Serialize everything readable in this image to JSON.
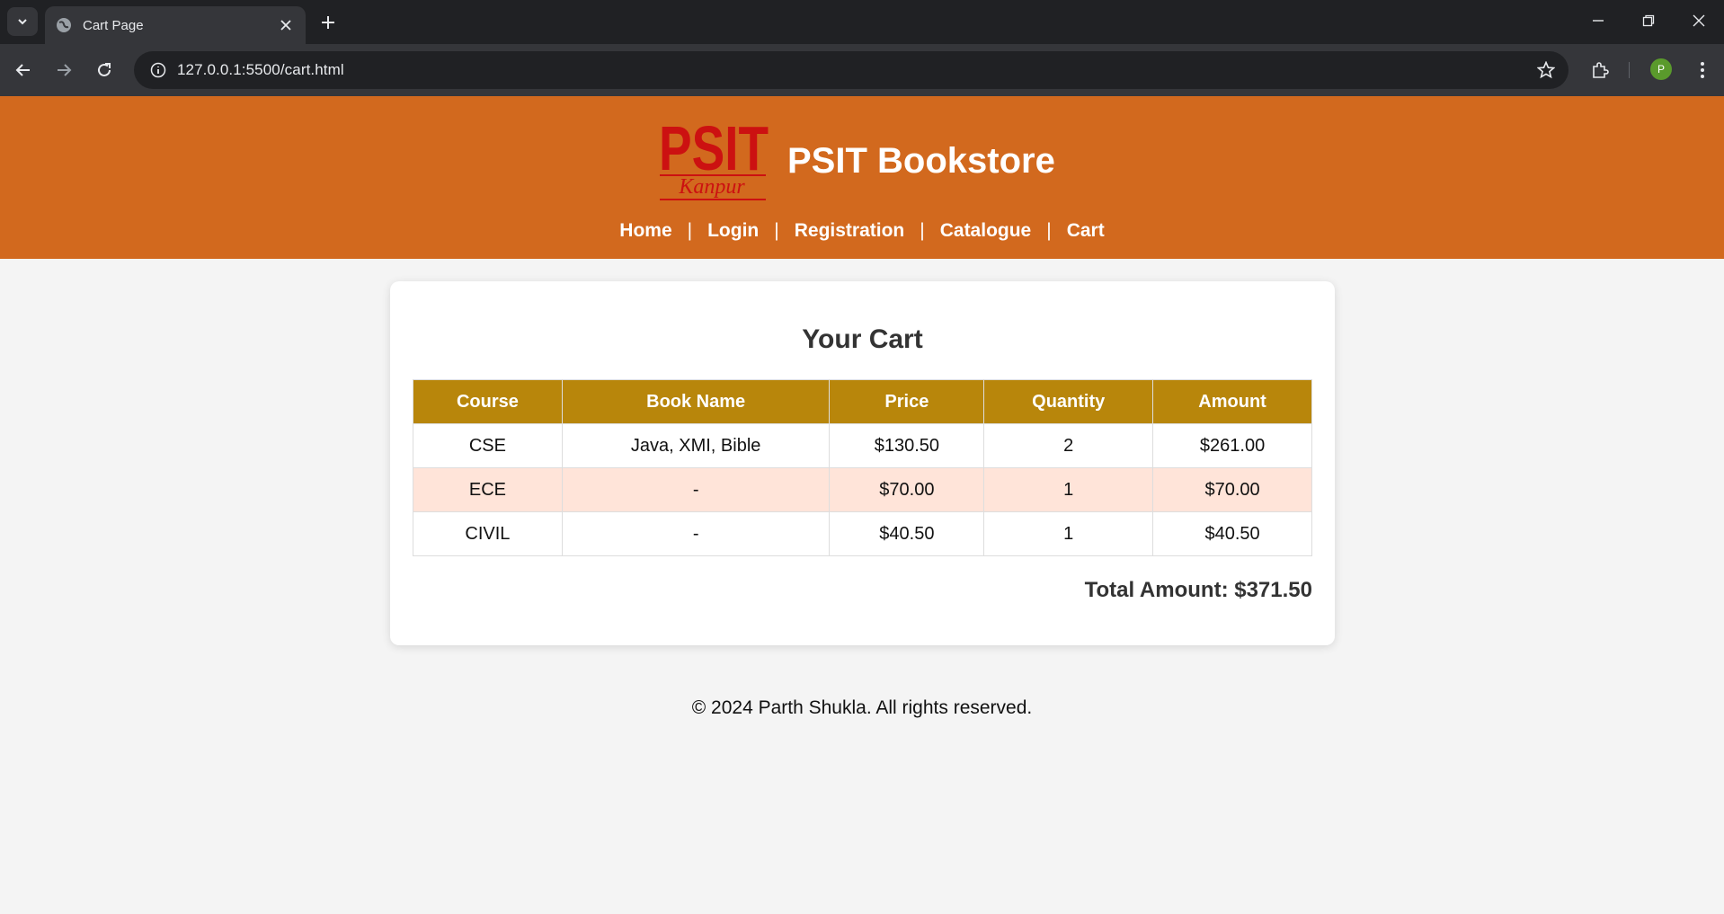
{
  "browser": {
    "tab_title": "Cart Page",
    "url": "127.0.0.1:5500/cart.html",
    "profile_initial": "P",
    "icons": [
      "tab-list-icon",
      "globe-icon",
      "close-icon",
      "plus-icon",
      "minimize-icon",
      "restore-icon",
      "window-close-icon",
      "back-arrow-icon",
      "forward-arrow-icon",
      "reload-icon",
      "site-info-icon",
      "star-icon",
      "extensions-icon",
      "kebab-menu-icon"
    ]
  },
  "header": {
    "logo_text": "PSIT",
    "logo_subtext": "Kanpur",
    "site_title": "PSIT Bookstore",
    "nav": [
      {
        "label": "Home"
      },
      {
        "label": "Login"
      },
      {
        "label": "Registration"
      },
      {
        "label": "Catalogue"
      },
      {
        "label": "Cart"
      }
    ],
    "separator": "|"
  },
  "cart": {
    "heading": "Your Cart",
    "columns": [
      "Course",
      "Book Name",
      "Price",
      "Quantity",
      "Amount"
    ],
    "rows": [
      {
        "course": "CSE",
        "book": "Java, XMI, Bible",
        "price": "$130.50",
        "qty": "2",
        "amount": "$261.00"
      },
      {
        "course": "ECE",
        "book": "-",
        "price": "$70.00",
        "qty": "1",
        "amount": "$70.00"
      },
      {
        "course": "CIVIL",
        "book": "-",
        "price": "$40.50",
        "qty": "1",
        "amount": "$40.50"
      }
    ],
    "total_label": "Total Amount: $371.50"
  },
  "footer": {
    "text": "© 2024 Parth Shukla. All rights reserved."
  },
  "colors": {
    "header_bg": "#d2691e",
    "table_header_bg": "#b8860b",
    "alt_row_bg": "#ffe4d9",
    "logo_red": "#cc1111"
  }
}
